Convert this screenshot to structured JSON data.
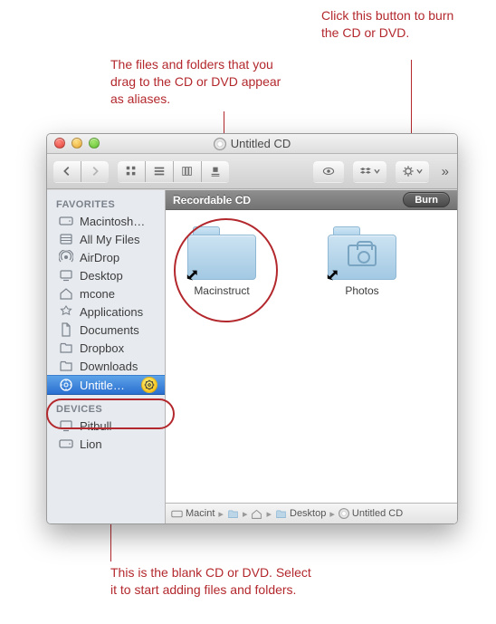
{
  "annotations": {
    "top_right": "Click this button to burn the CD or DVD.",
    "top_left": "The files and folders that you drag to the CD or DVD appear as aliases.",
    "bottom": "This is the blank CD or DVD. Select it to start adding files and folders."
  },
  "window": {
    "title": "Untitled CD"
  },
  "content_header": {
    "label": "Recordable CD",
    "burn_button": "Burn"
  },
  "sidebar": {
    "favorites_header": "FAVORITES",
    "devices_header": "DEVICES",
    "favorites": [
      {
        "label": "Macintosh…"
      },
      {
        "label": "All My Files"
      },
      {
        "label": "AirDrop"
      },
      {
        "label": "Desktop"
      },
      {
        "label": "mcone"
      },
      {
        "label": "Applications"
      },
      {
        "label": "Documents"
      },
      {
        "label": "Dropbox"
      },
      {
        "label": "Downloads"
      },
      {
        "label": "Untitle…"
      }
    ],
    "devices": [
      {
        "label": "Pitbull"
      },
      {
        "label": "Lion"
      }
    ]
  },
  "folders": [
    {
      "label": "Macinstruct"
    },
    {
      "label": "Photos"
    }
  ],
  "pathbar": {
    "segments": [
      "Macint",
      "",
      "",
      "Desktop",
      "Untitled CD"
    ]
  }
}
